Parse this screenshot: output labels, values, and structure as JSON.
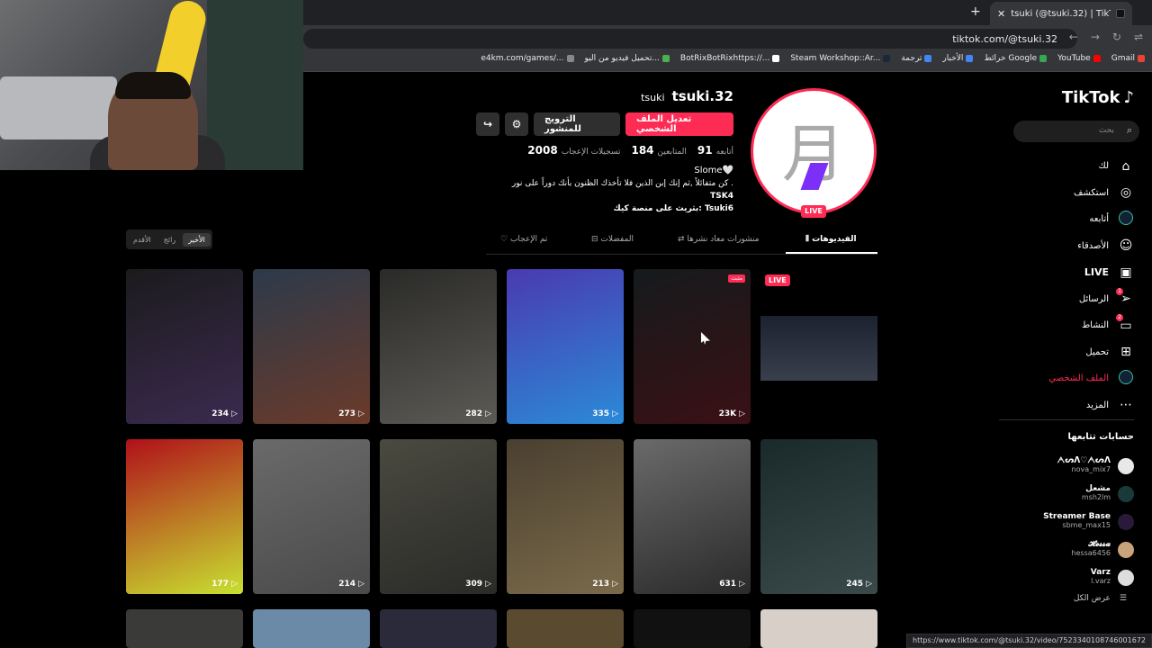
{
  "browser": {
    "tab_title": "tsuki (@tsuki.32) | TikTok",
    "new_tab": "+",
    "close": "✕",
    "url": "tiktok.com/@tsuki.32",
    "bookmarks": [
      {
        "label": "Gmail",
        "color": "#ea4335"
      },
      {
        "label": "YouTube",
        "color": "#ff0000"
      },
      {
        "label": "خرائط Google",
        "color": "#34a853"
      },
      {
        "label": "الأخبار",
        "color": "#4285f4"
      },
      {
        "label": "ترجمة",
        "color": "#4285f4"
      },
      {
        "label": "Steam Workshop::Ar...",
        "color": "#1b2838"
      },
      {
        "label": "BotRixBotRixhttps://...",
        "color": "#ffffff"
      },
      {
        "label": "تحميل فيديو من اليو...",
        "color": "#4caf50"
      },
      {
        "label": "e4km.com/games/...",
        "color": "#888888"
      }
    ],
    "status_url": "https://www.tiktok.com/@tsuki.32/video/7523340108746001672"
  },
  "sidebar": {
    "logo": "TikTok",
    "search_placeholder": "بحث",
    "items": [
      {
        "label": "لك",
        "icon": "home-icon",
        "glyph": "⌂"
      },
      {
        "label": "استكشف",
        "icon": "compass-icon",
        "glyph": "◎"
      },
      {
        "label": "أتابعه",
        "icon": "following-avatar-icon",
        "glyph": "◯"
      },
      {
        "label": "الأصدقاء",
        "icon": "friends-icon",
        "glyph": "☺"
      },
      {
        "label": "LIVE",
        "icon": "live-tv-icon",
        "glyph": "▣"
      },
      {
        "label": "الرسائل",
        "icon": "send-icon",
        "glyph": "➢",
        "badge": "1"
      },
      {
        "label": "النشاط",
        "icon": "chat-icon",
        "glyph": "▭",
        "badge": "2"
      },
      {
        "label": "تحميل",
        "icon": "upload-icon",
        "glyph": "⊞"
      },
      {
        "label": "الملف الشخصي",
        "icon": "profile-avatar-icon",
        "glyph": "◯"
      },
      {
        "label": "المزيد",
        "icon": "more-icon",
        "glyph": "⋯"
      }
    ],
    "following_title": "حسابات تتابعها",
    "following": [
      {
        "name": "ᗅᔕᐱ♡ᗅᔕᐱ",
        "user": "nova_mix7",
        "color": "#e8e8e8"
      },
      {
        "name": "مشعل",
        "user": "msh2lm",
        "color": "#1a3a3a"
      },
      {
        "name": "Streamer Base",
        "user": "sbme_max15",
        "color": "#2a1a3a"
      },
      {
        "name": "𝓗𝓮𝓼𝓼𝓪",
        "user": "hessa6456",
        "color": "#c9a37a"
      },
      {
        "name": "Varz",
        "user": "l.varz",
        "color": "#dddddd"
      }
    ],
    "see_all": "عرض الكل"
  },
  "profile": {
    "handle": "tsuki.32",
    "nickname": "tsuki",
    "avatar_glyph": "月",
    "live_label": "LIVE",
    "edit_button": "تعديل الملف الشخصي",
    "promote_button": "الترويج للمنشور",
    "stats": [
      {
        "n": "91",
        "l": "أتابعه"
      },
      {
        "n": "184",
        "l": "المتابعين"
      },
      {
        "n": "2008",
        "l": "تسجيلات الإعجاب"
      }
    ],
    "bio": [
      "Slome🤍",
      "كن متفائلاً ,ثم إنك إبن الذين فلا تأخذك الظنون بأنك دوراً على نور .",
      "TSK4",
      "بثريث على منصة كيك: Tsuki6"
    ]
  },
  "tabs": {
    "items": [
      "الفيديوهات",
      "منشورات معاد نشرها",
      "المفضلات",
      "تم الإعجاب"
    ],
    "sort": [
      "الأخير",
      "رائج",
      "الأقدم"
    ]
  },
  "videos": [
    {
      "views": "234",
      "color1": "#1b1b1d",
      "color2": "#3b2a4f"
    },
    {
      "views": "273",
      "color1": "#2c3a4a",
      "color2": "#6b3a2a"
    },
    {
      "views": "282",
      "color1": "#2a2a28",
      "color2": "#5c5a55"
    },
    {
      "views": "335",
      "color1": "#4a3ab0",
      "color2": "#2b8ad8"
    },
    {
      "views": "23K",
      "color1": "#151a1c",
      "color2": "#3a1015",
      "tag": "مثبت"
    },
    {
      "views": "177",
      "color1": "#b0101a",
      "color2": "#c8e030"
    },
    {
      "views": "214",
      "color1": "#6a6a6a",
      "color2": "#4a4a4a"
    },
    {
      "views": "309",
      "color1": "#4a4a40",
      "color2": "#2a2a28"
    },
    {
      "views": "213",
      "color1": "#4a4030",
      "color2": "#7a6a4a"
    },
    {
      "views": "631",
      "color1": "#6a6a6a",
      "color2": "#2a2a2a"
    },
    {
      "views": "245",
      "color1": "#1a2a2a",
      "color2": "#3a4a4a"
    }
  ],
  "live_tile": {
    "label": "LIVE"
  },
  "colors": {
    "accent": "#fe2c55",
    "bg": "#000000"
  }
}
